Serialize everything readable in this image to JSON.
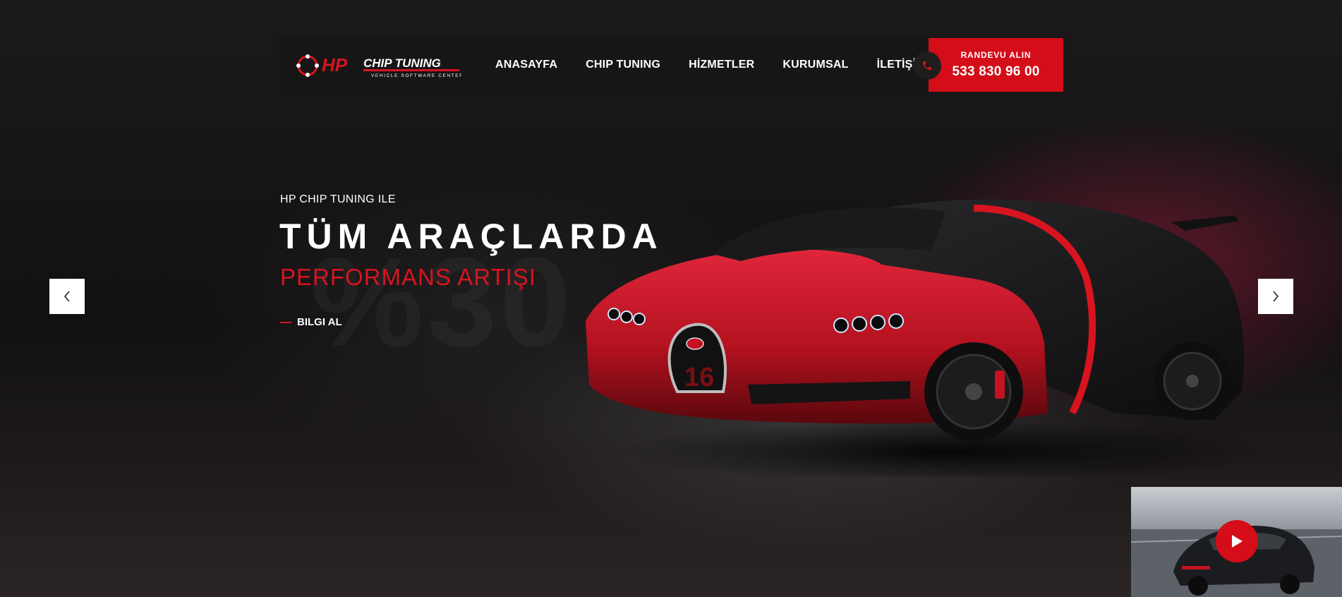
{
  "header": {
    "logo": {
      "brand": "HP",
      "name": "CHIP TUNING",
      "tagline": "VEHICLE SOFTWARE CENTER"
    },
    "nav": [
      {
        "label": "ANASAYFA"
      },
      {
        "label": "CHIP TUNING"
      },
      {
        "label": "HİZMETLER"
      },
      {
        "label": "KURUMSAL"
      },
      {
        "label": "İLETİŞİM"
      }
    ],
    "appointment": {
      "label": "RANDEVU ALIN",
      "phone": "533 830 96 00"
    }
  },
  "hero": {
    "kicker": "HP CHIP TUNING ILE",
    "title": "TÜM ARAÇLARDA",
    "subtitle": "PERFORMANS ARTIŞI",
    "background_text": "%30",
    "cta": "BILGI AL",
    "car_badge": "16"
  },
  "slider": {
    "prev_icon": "chevron-left-icon",
    "next_icon": "chevron-right-icon"
  },
  "video": {
    "play_icon": "play-icon"
  },
  "colors": {
    "accent": "#d40d19",
    "header_bg": "#171617",
    "page_bg": "#151314"
  }
}
